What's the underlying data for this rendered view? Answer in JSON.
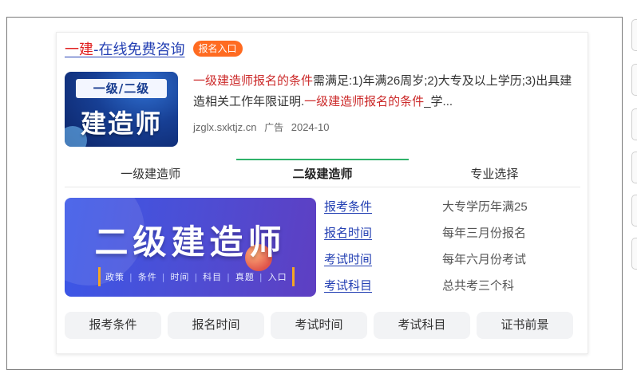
{
  "ad": {
    "title_highlight": "一建",
    "title_rest": "-在线免费咨询",
    "badge": "报名入口",
    "thumb": {
      "line1": "一级/二级",
      "line2": "建造师"
    },
    "description": {
      "part1": "一级建造师报名的条件",
      "part2": "需满足:1)年满26周岁;2)大专及以上学历;3)出具建造相关工作年限证明.",
      "part3": "一级建造师报名的条件",
      "part4": "_学..."
    },
    "domain": "jzglx.sxktjz.cn",
    "ad_label": "广告",
    "date": "2024-10"
  },
  "tabs": [
    {
      "label": "一级建造师"
    },
    {
      "label": "二级建造师"
    },
    {
      "label": "专业选择"
    }
  ],
  "banner": {
    "headline": "二级建造师",
    "tags": [
      "政策",
      "条件",
      "时间",
      "科目",
      "真题",
      "入口"
    ]
  },
  "info": {
    "links": [
      "报考条件",
      "报名时间",
      "考试时间",
      "考试科目"
    ],
    "values": [
      "大专学历年满25",
      "每年三月份报名",
      "每年六月份考试",
      "总共考三个科"
    ]
  },
  "buttons": [
    "报考条件",
    "报名时间",
    "考试时间",
    "考试科目",
    "证书前景"
  ],
  "colors": {
    "link": "#2440b3",
    "highlight_red": "#cc2a2a",
    "badge_orange": "#ff6b21",
    "active_tab_green": "#2fb36a"
  }
}
